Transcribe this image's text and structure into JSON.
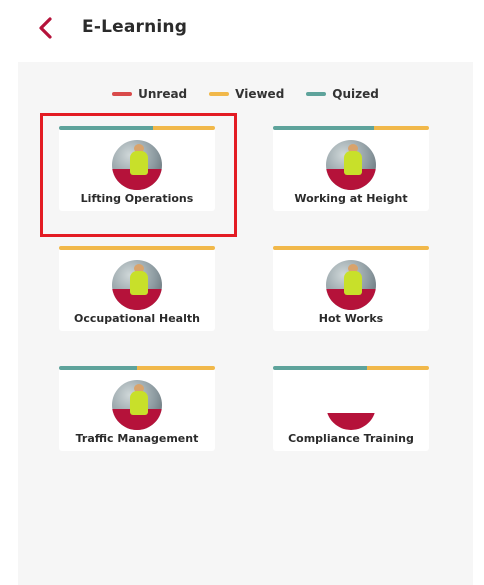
{
  "header": {
    "title": "E-Learning",
    "back_icon": "chevron-left-icon"
  },
  "colors": {
    "unread": "#d94a4a",
    "viewed": "#f1b84a",
    "quized": "#5ea39b",
    "accent": "#b5123a",
    "highlight": "#e31b23"
  },
  "legend": [
    {
      "label": "Unread",
      "color": "#d94a4a"
    },
    {
      "label": "Viewed",
      "color": "#f1b84a"
    },
    {
      "label": "Quized",
      "color": "#5ea39b"
    }
  ],
  "modules": [
    {
      "label": "Lifting Operations",
      "progress": [
        {
          "status": "quized",
          "fraction": 0.6
        },
        {
          "status": "viewed",
          "fraction": 0.4
        }
      ],
      "highlighted": true
    },
    {
      "label": "Working at Height",
      "progress": [
        {
          "status": "quized",
          "fraction": 0.65
        },
        {
          "status": "viewed",
          "fraction": 0.35
        }
      ]
    },
    {
      "label": "Occupational Health",
      "progress": [
        {
          "status": "viewed",
          "fraction": 1.0
        }
      ]
    },
    {
      "label": "Hot Works",
      "progress": [
        {
          "status": "viewed",
          "fraction": 1.0
        }
      ]
    },
    {
      "label": "Traffic Management",
      "progress": [
        {
          "status": "quized",
          "fraction": 0.5
        },
        {
          "status": "viewed",
          "fraction": 0.5
        }
      ]
    },
    {
      "label": "Compliance Training",
      "progress": [
        {
          "status": "quized",
          "fraction": 0.6
        },
        {
          "status": "viewed",
          "fraction": 0.4
        }
      ]
    }
  ]
}
